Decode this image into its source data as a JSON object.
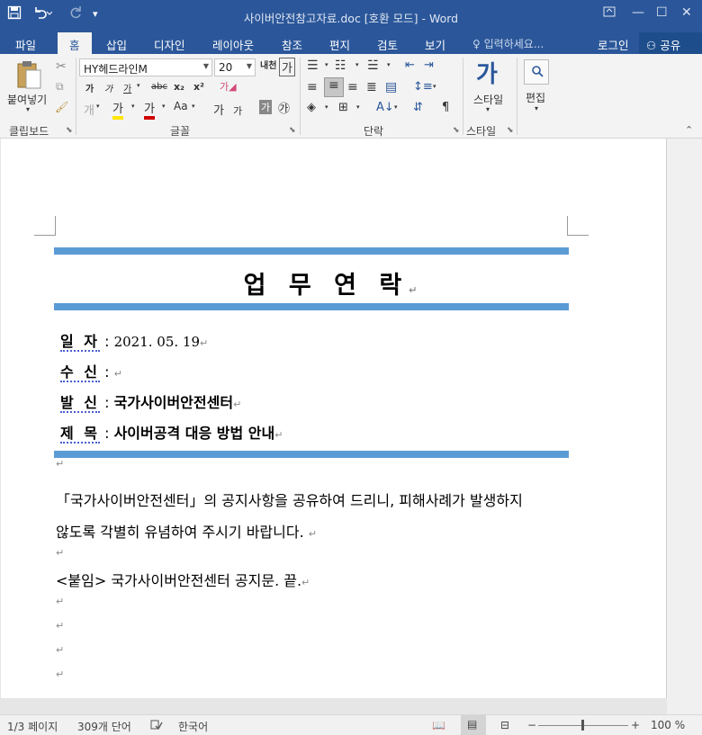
{
  "window": {
    "title": "사이버안전참고자료.doc [호환 모드] - Word",
    "qa_save_icon": "save-icon",
    "qa_undo_icon": "undo-icon",
    "qa_redo_icon": "redo-icon"
  },
  "tabs": [
    "파일",
    "홈",
    "삽입",
    "디자인",
    "레이아웃",
    "참조",
    "편지",
    "검토",
    "보기"
  ],
  "tell_me": "입력하세요...",
  "login": "로그인",
  "share": "공유",
  "ribbon": {
    "clipboard": {
      "paste_label": "붙여넣기",
      "group_label": "클립보드"
    },
    "font": {
      "name": "HY헤드라인M",
      "size": "20",
      "group_label": "글꼴",
      "case_label": "Aa"
    },
    "paragraph": {
      "group_label": "단락"
    },
    "styles": {
      "button_label": "스타일",
      "group_label": "스타일",
      "glyph": "가"
    },
    "editing": {
      "button_label": "편집"
    }
  },
  "document": {
    "heading": "업 무 연 락",
    "fields": [
      {
        "label": "일 자",
        "colon": " : ",
        "value": "2021. 05. 19"
      },
      {
        "label": "수 신",
        "colon": " : ",
        "value": ""
      },
      {
        "label": "발 신",
        "colon": " : ",
        "value": "국가사이버안전센터"
      },
      {
        "label": "제 목",
        "colon": " : ",
        "value": "사이버공격 대응 방법 안내"
      }
    ],
    "body_line1": "「국가사이버안전센터」의 공지사항을 공유하여 드리니, 피해사례가 발생하지",
    "body_line2": "않도록 각별히 유념하여 주시기 바랍니다.",
    "attachment": "<붙임> 국가사이버안전센터 공지문. 끝."
  },
  "status": {
    "page": "1/3 페이지",
    "words": "309개 단어",
    "language": "한국어",
    "zoom": "100 %",
    "zoom_percent": 100
  }
}
